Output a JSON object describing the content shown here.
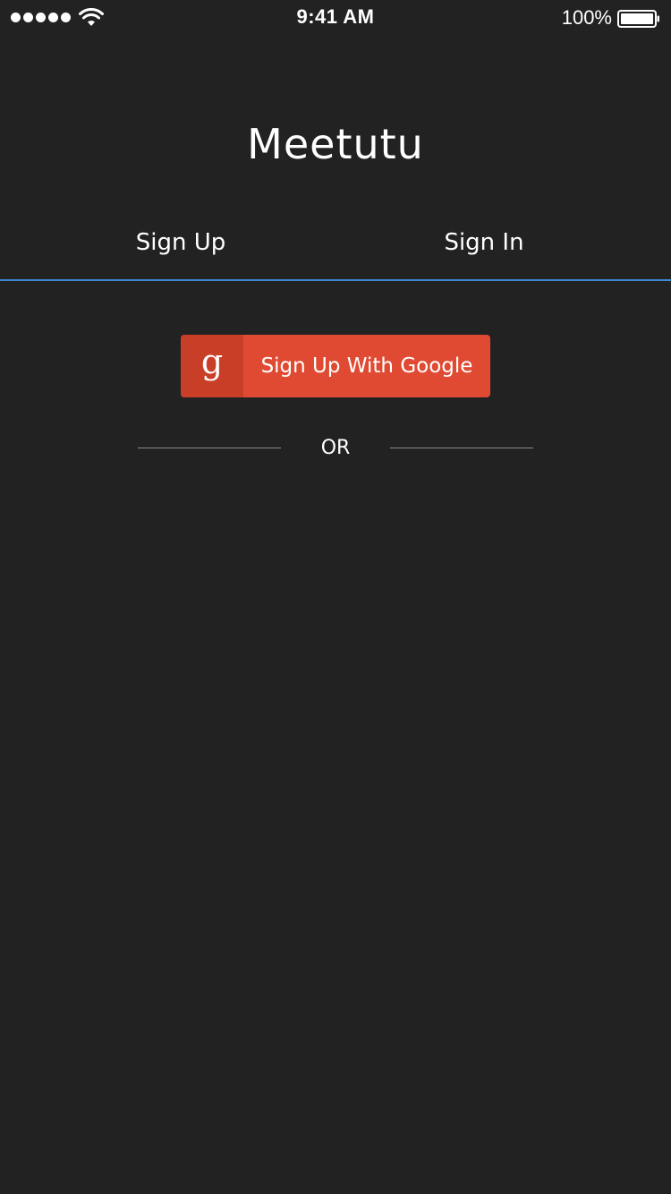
{
  "status_bar": {
    "time": "9:41 AM",
    "battery_percent": "100%",
    "signal_icon": "signal-dots-icon",
    "wifi_icon": "wifi-icon",
    "battery_icon": "battery-icon"
  },
  "app": {
    "title": "Meetutu"
  },
  "tabs": [
    {
      "label": "Sign Up",
      "active": true
    },
    {
      "label": "Sign In",
      "active": false
    }
  ],
  "google_button": {
    "icon_glyph": "g",
    "icon": "google-g-icon",
    "label": "Sign Up With Google"
  },
  "divider": {
    "label": "OR"
  },
  "colors": {
    "background": "#222222",
    "accent": "#3f87d6",
    "google_red": "#e04a32",
    "google_red_dark": "#c93e27"
  }
}
